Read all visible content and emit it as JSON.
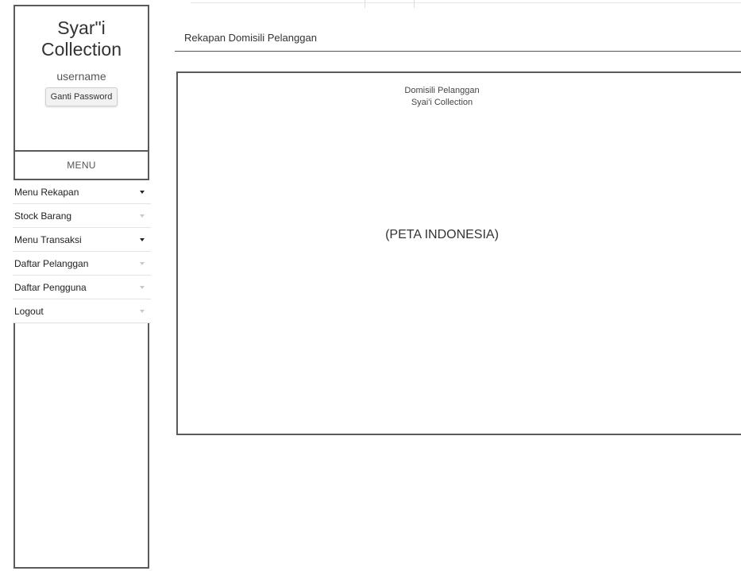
{
  "sidebar": {
    "brand_line1": "Syar\"i",
    "brand_line2": "Collection",
    "username": "username",
    "change_password_label": "Ganti Password",
    "menu_header": "MENU",
    "items": [
      {
        "label": "Menu Rekapan",
        "caret": "dark"
      },
      {
        "label": "Stock Barang",
        "caret": "light"
      },
      {
        "label": "Menu Transaksi",
        "caret": "dark"
      },
      {
        "label": "Daftar Pelanggan",
        "caret": "light"
      },
      {
        "label": "Daftar Pengguna",
        "caret": "light"
      },
      {
        "label": "Logout",
        "caret": "light"
      }
    ]
  },
  "main": {
    "title": "Rekapan Domisili Pelanggan",
    "map_caption_line1": "Domisili Pelanggan",
    "map_caption_line2": "Syai'i Collection",
    "map_placeholder": "(PETA INDONESIA)"
  }
}
